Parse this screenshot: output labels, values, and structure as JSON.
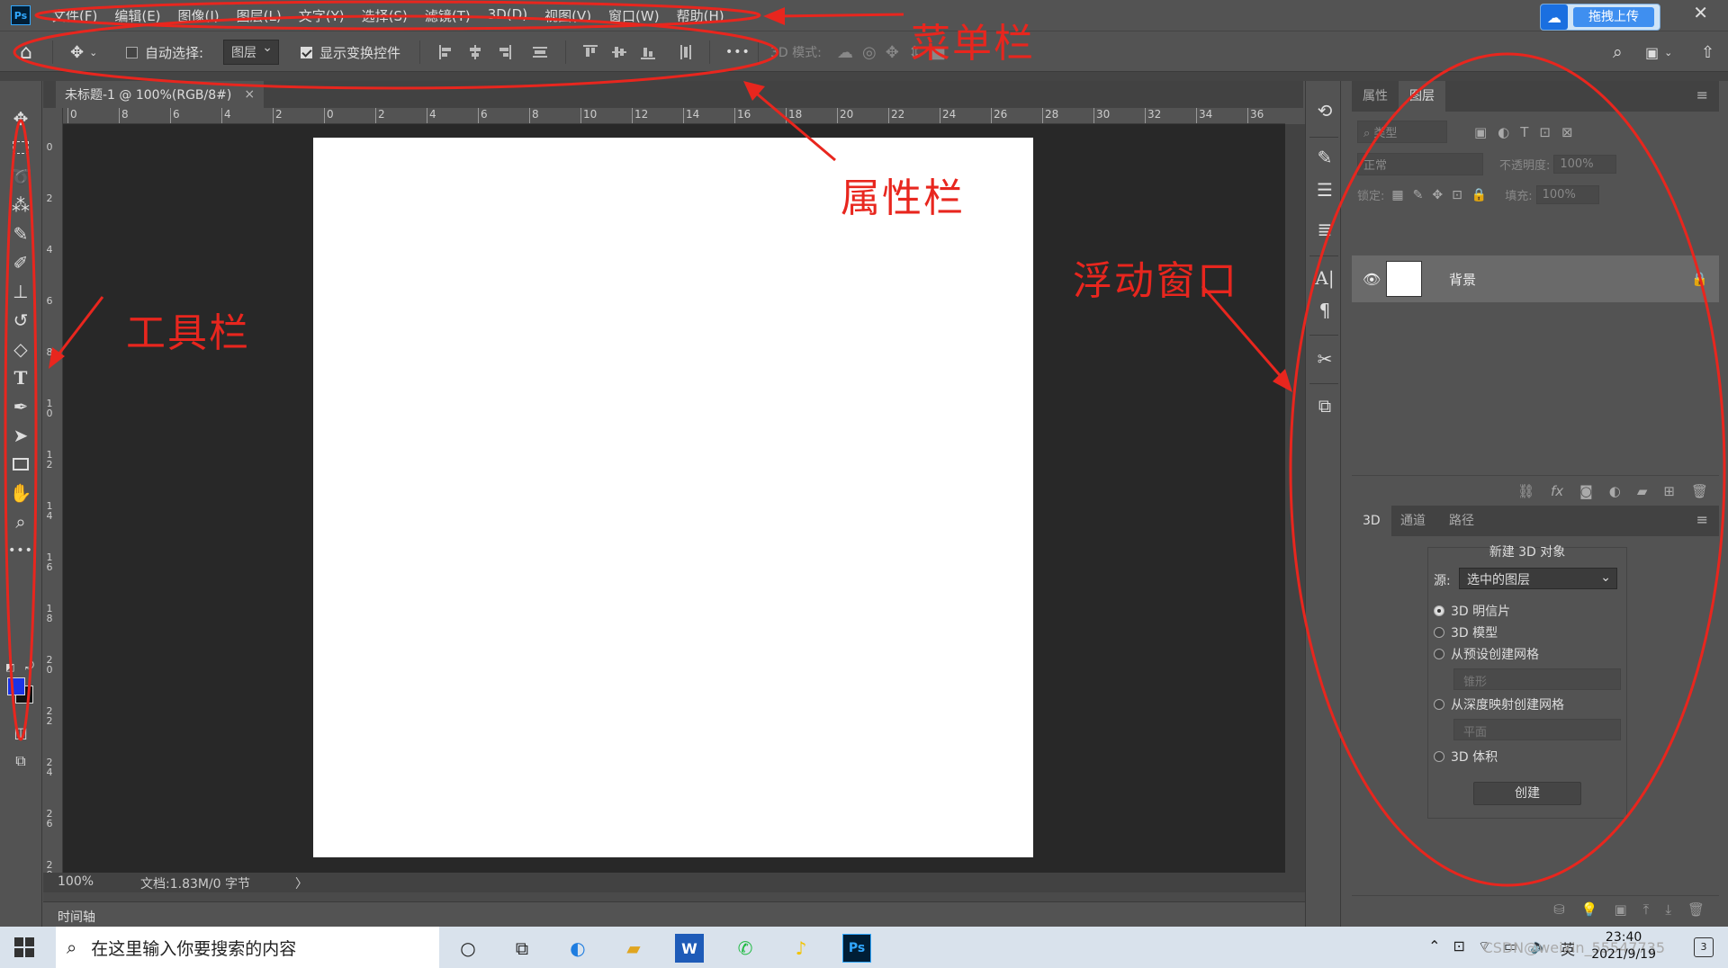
{
  "app": {
    "logo": "Ps",
    "menus": [
      "文件(F)",
      "编辑(E)",
      "图像(I)",
      "图层(L)",
      "文字(Y)",
      "选择(S)",
      "滤镜(T)",
      "3D(D)",
      "视图(V)",
      "窗口(W)",
      "帮助(H)"
    ],
    "upload_label": "拖拽上传",
    "close_glyph": "✕"
  },
  "options": {
    "auto_select_label": "自动选择:",
    "auto_select_checked": false,
    "target_value": "图层",
    "show_transform_label": "显示变换控件",
    "show_transform_checked": true,
    "more_glyph": "•••",
    "mode_3d_label": "3D 模式:"
  },
  "document": {
    "tab_title": "未标题-1 @ 100%(RGB/8#)",
    "close_glyph": "×",
    "zoom": "100%",
    "doc_info": "文档:1.83M/0 字节",
    "arrow": "〉"
  },
  "rulers": {
    "h_labels": [
      "0",
      "8",
      "6",
      "4",
      "2",
      "0",
      "2",
      "4",
      "6",
      "8",
      "10",
      "12",
      "14",
      "16",
      "18",
      "20",
      "22",
      "24",
      "26",
      "28",
      "30",
      "32",
      "34",
      "36"
    ],
    "v_labels": [
      "0",
      "2",
      "4",
      "6",
      "8",
      "1 0",
      "1 2",
      "1 4",
      "1 6",
      "1 8",
      "2 0",
      "2 2",
      "2 4",
      "2 6",
      "2 8"
    ]
  },
  "colors": {
    "foreground": "#1b33e6",
    "background": "#111111",
    "annotation": "#e8261e"
  },
  "timeline": {
    "label": "时间轴"
  },
  "panels": {
    "top_tabs": [
      "属性",
      "图层"
    ],
    "active_top_tab": "图层",
    "filter_label": "类型",
    "blend_mode": "正常",
    "opacity_label": "不透明度:",
    "opacity_value": "100%",
    "lock_label": "锁定:",
    "fill_label": "填充:",
    "fill_value": "100%",
    "layers": [
      {
        "name": "背景",
        "visible": true,
        "locked": true
      }
    ],
    "bottom_tabs": [
      "3D",
      "通道",
      "路径"
    ],
    "active_bottom_tab": "3D",
    "new_3d_title": "新建 3D 对象",
    "source_label": "源:",
    "source_value": "选中的图层",
    "options_3d": [
      "3D 明信片",
      "3D 模型",
      "从预设创建网格",
      "从深度映射创建网格",
      "3D 体积"
    ],
    "selected_3d_option": "3D 明信片",
    "preset_value": "锥形",
    "depth_value": "平面",
    "create_label": "创建"
  },
  "annotations": {
    "menu": "菜单栏",
    "options": "属性栏",
    "tools": "工具栏",
    "floating": "浮动窗口"
  },
  "taskbar": {
    "search_placeholder": "在这里输入你要搜索的内容",
    "time": "23:40",
    "date": "2021/9/19",
    "ime": "英",
    "watermark": "CSDN@weixin_55547735",
    "notify_count": "3"
  }
}
